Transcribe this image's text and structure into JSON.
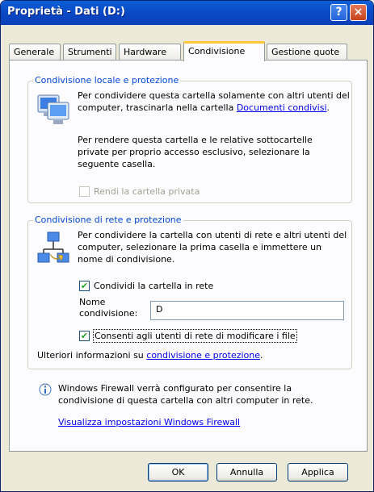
{
  "window": {
    "title": "Proprietà - Dati (D:)",
    "help": "?",
    "close": "×"
  },
  "tabs": [
    {
      "label": "Generale"
    },
    {
      "label": "Strumenti"
    },
    {
      "label": "Hardware"
    },
    {
      "label": "Condivisione"
    },
    {
      "label": "Gestione quote"
    }
  ],
  "local": {
    "legend": "Condivisione locale e protezione",
    "text1": "Per condividere questa cartella solamente con altri utenti del computer, trascinarla nella cartella ",
    "link": "Documenti condivisi",
    "text1_end": ".",
    "text2": "Per rendere questa cartella e le relative sottocartelle private per proprio accesso esclusivo, selezionare la seguente casella.",
    "private_checkbox": "Rendi la cartella privata"
  },
  "network": {
    "legend": "Condivisione di rete e protezione",
    "text": "Per condividere la cartella con utenti di rete e altri utenti del computer, selezionare la prima casella e immettere un nome di condivisione.",
    "share_checkbox": "Condividi la cartella in rete",
    "share_name_label_1": "Nome",
    "share_name_label_2": "condivisione:",
    "share_name_value": "D",
    "modify_checkbox": "Consenti agli utenti di rete di modificare i file",
    "more_info_prefix": "Ulteriori informazioni su ",
    "more_info_link": "condivisione e protezione",
    "more_info_suffix": "."
  },
  "firewall": {
    "info_icon": "info-icon",
    "text": "Windows Firewall verrà configurato per consentire la condivisione di questa cartella con altri computer in rete.",
    "link": "Visualizza impostazioni Windows Firewall"
  },
  "buttons": {
    "ok": "OK",
    "cancel": "Annulla",
    "apply": "Applica"
  }
}
